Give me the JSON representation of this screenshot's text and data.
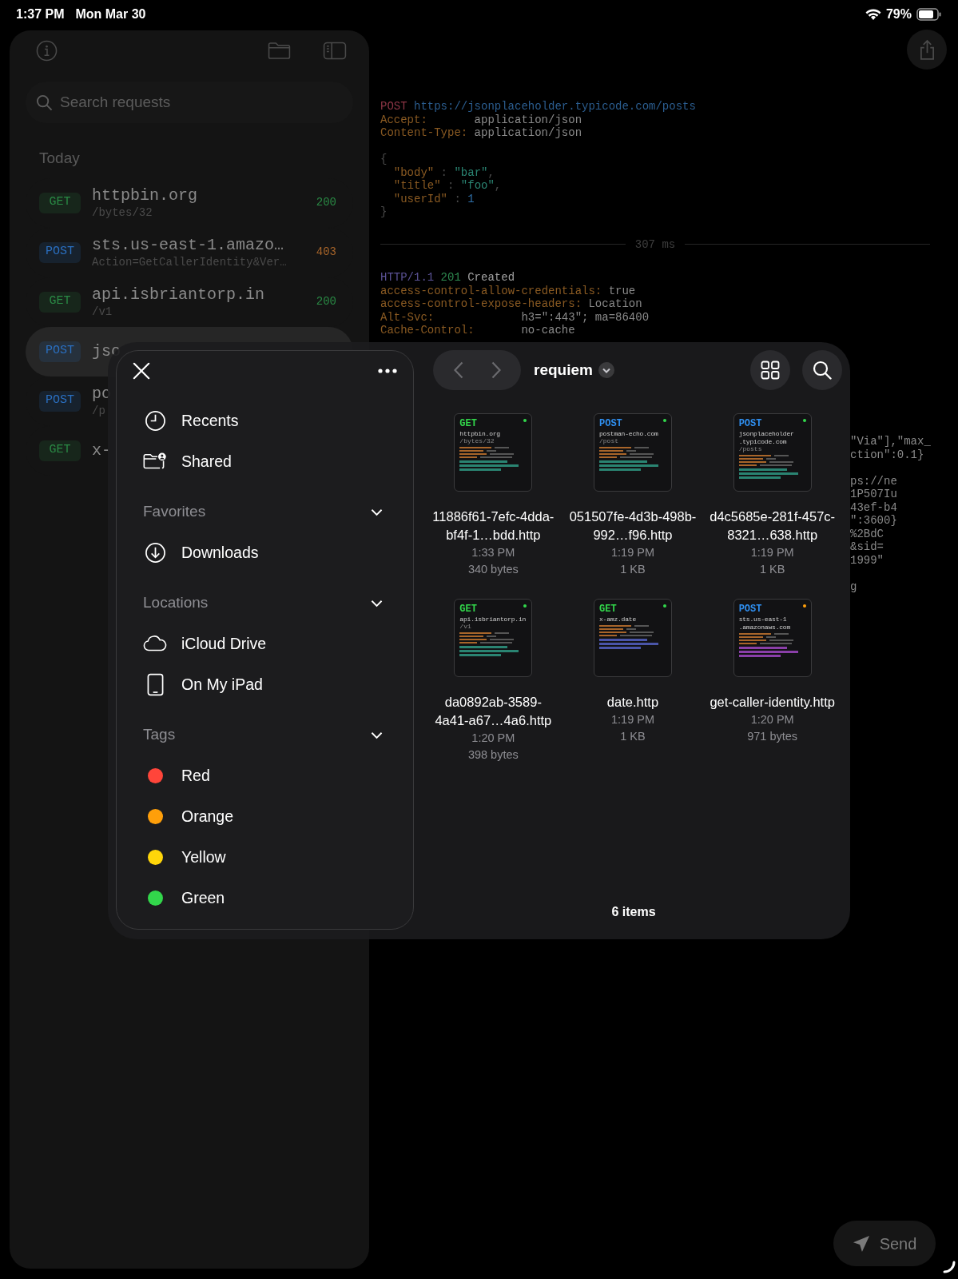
{
  "status_bar": {
    "time": "1:37 PM",
    "date": "Mon Mar 30",
    "battery": "79%"
  },
  "sidebar": {
    "search": {
      "placeholder": "Search requests"
    },
    "section": "Today",
    "requests": [
      {
        "method": {
          "text": "GET",
          "color": "#2a8a45"
        },
        "host": "httpbin.org",
        "path": "/bytes/32",
        "status": {
          "text": "200",
          "color": "#2a8a45"
        },
        "selected": false
      },
      {
        "method": {
          "text": "POST",
          "color": "#2a6fc0"
        },
        "host": "sts.us-east-1.amazo…",
        "path": "Action=GetCallerIdentity&Ver…",
        "status": {
          "text": "403",
          "color": "#a8652a"
        },
        "selected": false
      },
      {
        "method": {
          "text": "GET",
          "color": "#2a8a45"
        },
        "host": "api.isbriantorp.in",
        "path": "/v1",
        "status": {
          "text": "200",
          "color": "#2a8a45"
        },
        "selected": false
      },
      {
        "method": {
          "text": "POST",
          "color": "#2a6fc0"
        },
        "host": "jso",
        "selected": true
      },
      {
        "method": {
          "text": "POST",
          "color": "#2a6fc0"
        },
        "host": "po",
        "path": "/p",
        "selected": false
      },
      {
        "method": {
          "text": "GET",
          "color": "#2a8a45"
        },
        "host": "x-",
        "selected": false
      }
    ]
  },
  "request": {
    "lines": [
      {
        "segments": [
          {
            "text": "POST",
            "kind": "method"
          },
          {
            "text": "https://jsonplaceholder.typicode.com/posts",
            "kind": "url"
          }
        ]
      },
      {
        "segments": [
          {
            "text": "Accept:",
            "kind": "key"
          },
          {
            "text": "application/json",
            "kind": "value"
          }
        ]
      },
      {
        "segments": [
          {
            "text": "Content-Type:",
            "kind": "key"
          },
          {
            "text": "application/json",
            "kind": "value"
          }
        ]
      }
    ],
    "body": [
      {
        "indent": false,
        "segments": [
          {
            "text": "{",
            "kind": "punct"
          }
        ]
      },
      {
        "indent": true,
        "segments": [
          {
            "text": "\"body\"",
            "kind": "key"
          },
          {
            "text": " : ",
            "kind": "punct"
          },
          {
            "text": "\"bar\"",
            "kind": "string"
          },
          {
            "text": ",",
            "kind": "punct"
          }
        ]
      },
      {
        "indent": true,
        "segments": [
          {
            "text": "\"title\"",
            "kind": "key"
          },
          {
            "text": " : ",
            "kind": "punct"
          },
          {
            "text": "\"foo\"",
            "kind": "string"
          },
          {
            "text": ",",
            "kind": "punct"
          }
        ]
      },
      {
        "indent": true,
        "segments": [
          {
            "text": "\"userId\"",
            "kind": "key"
          },
          {
            "text": " : ",
            "kind": "punct"
          },
          {
            "text": "1",
            "kind": "number"
          }
        ]
      },
      {
        "indent": false,
        "segments": [
          {
            "text": "}",
            "kind": "punct"
          }
        ]
      }
    ]
  },
  "timing": "307 ms",
  "response": {
    "lines": [
      {
        "segments": [
          {
            "text": "HTTP/1.1",
            "kind": "proto"
          },
          {
            "text": "201",
            "kind": "status"
          },
          {
            "text": "Created",
            "kind": "plain"
          }
        ]
      },
      {
        "segments": [
          {
            "text": "access-control-allow-credentials:",
            "kind": "key"
          },
          {
            "text": "true",
            "kind": "value"
          }
        ]
      },
      {
        "segments": [
          {
            "text": "access-control-expose-headers:",
            "kind": "key"
          },
          {
            "text": "Location",
            "kind": "value"
          }
        ]
      },
      {
        "segments": [
          {
            "text": "Alt-Svc:",
            "kind": "key"
          },
          {
            "text": "h3=\":443\"; ma=86400",
            "kind": "value"
          }
        ]
      },
      {
        "segments": [
          {
            "text": "Cache-Control:",
            "kind": "key"
          },
          {
            "text": "no-cache",
            "kind": "value"
          }
        ]
      }
    ]
  },
  "response_fragments": [
    [
      "\"Via\"],\"max_",
      "ction\":0.1}"
    ],
    [
      "ps://ne",
      "1P507Iu",
      "43ef-b4",
      "\":3600}",
      "%2BdC",
      "&sid=",
      "1999\""
    ],
    [
      "g"
    ]
  ],
  "file_browser": {
    "sidebar": [
      {
        "items": [
          {
            "kind": "recents",
            "label": "Recents"
          },
          {
            "kind": "shared",
            "label": "Shared"
          }
        ]
      },
      {
        "title": "Favorites",
        "expanded": true,
        "items": [
          {
            "kind": "downloads",
            "label": "Downloads"
          }
        ]
      },
      {
        "title": "Locations",
        "expanded": true,
        "items": [
          {
            "kind": "cloud",
            "label": "iCloud Drive"
          },
          {
            "kind": "tablet",
            "label": "On My iPad"
          }
        ]
      },
      {
        "title": "Tags",
        "expanded": true,
        "items": [
          {
            "kind": "tag",
            "label": "Red",
            "color": "#ff453a"
          },
          {
            "kind": "tag",
            "label": "Orange",
            "color": "#ff9f0a"
          },
          {
            "kind": "tag",
            "label": "Yellow",
            "color": "#ffd60a"
          },
          {
            "kind": "tag",
            "label": "Green",
            "color": "#32d74b"
          }
        ]
      }
    ],
    "folder": "requiem",
    "files": [
      {
        "method": {
          "text": "GET",
          "color": "#32d74b"
        },
        "host_lines": [
          "httpbin.org"
        ],
        "path": "/bytes/32",
        "color": "#32d74b",
        "preview": {
          "color": "#2a8472"
        },
        "name": "11886f61-7efc-4dda-bf4f-1…bdd.http",
        "time": "1:33 PM",
        "size": "340 bytes"
      },
      {
        "method": {
          "text": "POST",
          "color": "#2f8ff0"
        },
        "host_lines": [
          "postman-echo.com"
        ],
        "path": "/post",
        "color": "#32d74b",
        "preview": {
          "color": "#2a8472"
        },
        "name": "051507fe-4d3b-498b-992…f96.http",
        "time": "1:19 PM",
        "size": "1 KB"
      },
      {
        "method": {
          "text": "POST",
          "color": "#2f8ff0"
        },
        "host_lines": [
          "jsonplaceholder",
          ".typicode.com"
        ],
        "path": "/posts",
        "color": "#32d74b",
        "preview": {
          "color": "#2a8472"
        },
        "name": "d4c5685e-281f-457c-8321…638.http",
        "time": "1:19 PM",
        "size": "1 KB"
      },
      {
        "method": {
          "text": "GET",
          "color": "#32d74b"
        },
        "host_lines": [
          "api.isbriantorp.in"
        ],
        "path": "/v1",
        "color": "#32d74b",
        "preview": {
          "color": "#2a8472"
        },
        "name": "da0892ab-3589-4a41-a67…4a6.http",
        "time": "1:20 PM",
        "size": "398 bytes"
      },
      {
        "method": {
          "text": "GET",
          "color": "#32d74b"
        },
        "host_lines": [
          "x-amz.date"
        ],
        "color": "#32d74b",
        "preview": {
          "color": "#4a55a8"
        },
        "name": "date.http",
        "time": "1:19 PM",
        "size": "1 KB"
      },
      {
        "method": {
          "text": "POST",
          "color": "#2f8ff0"
        },
        "host_lines": [
          "sts.us-east-1",
          ".amazonaws.com"
        ],
        "color": "#ff9f0a",
        "preview": {
          "color": "#8a3fa8"
        },
        "name": "get-caller-identity.http",
        "time": "1:20 PM",
        "size": "971 bytes"
      }
    ],
    "count": "6 items"
  },
  "send_button": "Send"
}
